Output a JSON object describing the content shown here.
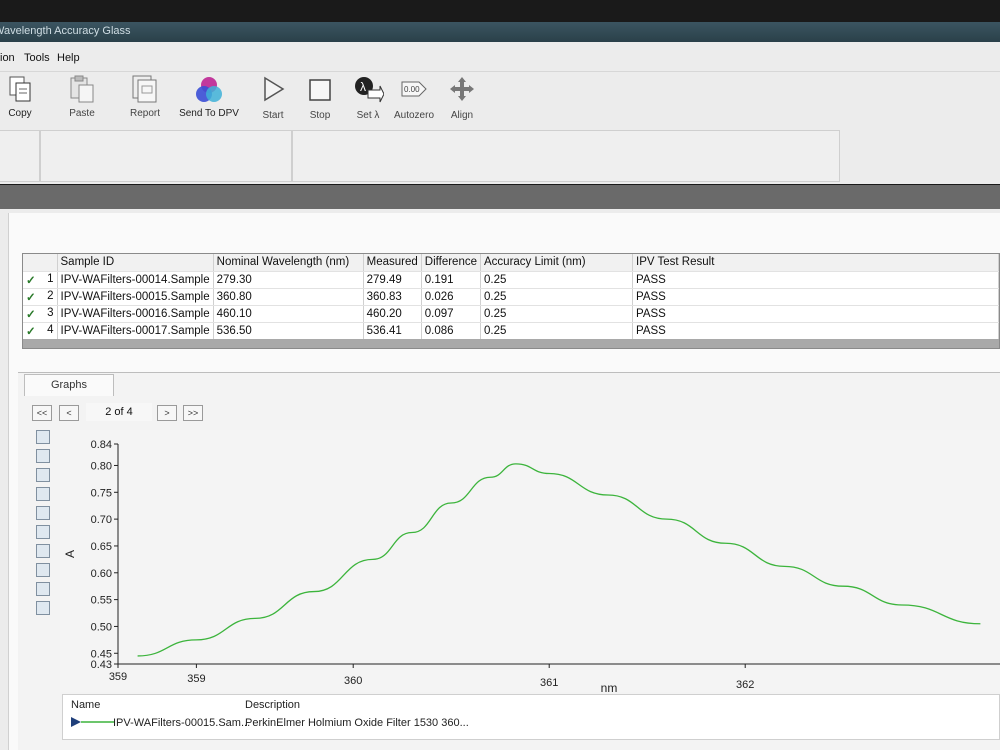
{
  "window": {
    "title": "Wavelength Accuracy Glass"
  },
  "menu": [
    "ion",
    "Tools",
    "Help"
  ],
  "toolbar": {
    "copy": "Copy",
    "paste": "Paste",
    "report": "Report",
    "send": "Send To DPV",
    "start": "Start",
    "stop": "Stop",
    "setl": "Set λ",
    "autozero": "Autozero",
    "align": "Align",
    "autozero_icon_text": "0.00"
  },
  "table": {
    "headers": [
      "Sample ID",
      "Nominal Wavelength (nm)",
      "Measured",
      "Difference",
      "Accuracy Limit (nm)",
      "IPV Test Result"
    ],
    "rows": [
      {
        "check": "✓",
        "n": "1",
        "id": "IPV-WAFilters-00014.Sample",
        "nominal": "279.30",
        "measured": "279.49",
        "diff": "0.191",
        "limit": "0.25",
        "result": "PASS"
      },
      {
        "check": "✓",
        "n": "2",
        "id": "IPV-WAFilters-00015.Sample",
        "nominal": "360.80",
        "measured": "360.83",
        "diff": "0.026",
        "limit": "0.25",
        "result": "PASS"
      },
      {
        "check": "✓",
        "n": "3",
        "id": "IPV-WAFilters-00016.Sample",
        "nominal": "460.10",
        "measured": "460.20",
        "diff": "0.097",
        "limit": "0.25",
        "result": "PASS"
      },
      {
        "check": "✓",
        "n": "4",
        "id": "IPV-WAFilters-00017.Sample",
        "nominal": "536.50",
        "measured": "536.41",
        "diff": "0.086",
        "limit": "0.25",
        "result": "PASS"
      }
    ]
  },
  "graphs": {
    "tab": "Graphs",
    "nav": {
      "first": "<<",
      "prev": "<",
      "next": ">",
      "last": ">>",
      "page": "2 of 4"
    }
  },
  "legend": {
    "name_header": "Name",
    "desc_header": "Description",
    "name": "IPV-WAFilters-00015.Sam...",
    "description": "PerkinElmer Holmium Oxide Filter 1530 360...",
    "color": "#3cb43c"
  },
  "chart_data": {
    "type": "line",
    "xlabel": "nm",
    "ylabel": "A",
    "x_ticks": [
      359,
      359,
      360,
      361,
      362
    ],
    "y_ticks": [
      "0.43",
      "0.45",
      "0.50",
      "0.55",
      "0.60",
      "0.65",
      "0.70",
      "0.75",
      "0.80",
      "0.84"
    ],
    "xlim": [
      358.8,
      363.3
    ],
    "ylim": [
      0.43,
      0.84
    ],
    "series": [
      {
        "color": "#3cb43c",
        "x": [
          358.9,
          359.2,
          359.5,
          359.8,
          360.1,
          360.3,
          360.5,
          360.7,
          360.83,
          361.0,
          361.3,
          361.6,
          361.9,
          362.2,
          362.5,
          362.8,
          363.2
        ],
        "y": [
          0.445,
          0.475,
          0.515,
          0.565,
          0.625,
          0.675,
          0.73,
          0.778,
          0.803,
          0.785,
          0.745,
          0.7,
          0.655,
          0.612,
          0.575,
          0.54,
          0.505
        ]
      }
    ]
  }
}
